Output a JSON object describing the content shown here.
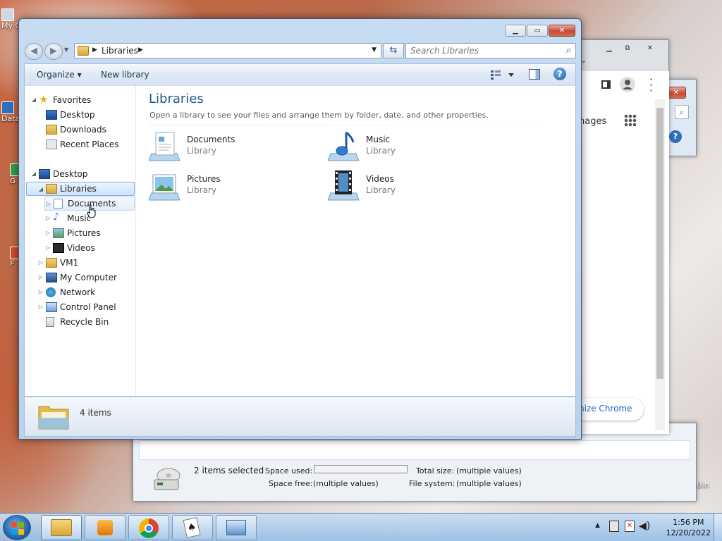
{
  "desktop": {
    "icons": [
      {
        "label": "My C"
      },
      {
        "label": "Data"
      },
      {
        "label": "G C"
      },
      {
        "label": "F"
      },
      {
        "label": "Bin"
      }
    ]
  },
  "background_chrome": {
    "images_link": "nages",
    "customize_button": "nize Chrome"
  },
  "background_props": {
    "selected": "2 items selected",
    "space_used_label": "Space used:",
    "space_free_label": "Space free:",
    "space_free_value": "(multiple values)",
    "total_size_label": "Total size:",
    "total_size_value": "(multiple values)",
    "file_system_label": "File system:",
    "file_system_value": "(multiple values)"
  },
  "explorer": {
    "address": "Libraries",
    "search_placeholder": "Search Libraries",
    "commands": {
      "organize": "Organize ▾",
      "new_library": "New library"
    },
    "tree": {
      "favorites": "Favorites",
      "desktop_fav": "Desktop",
      "downloads": "Downloads",
      "recent": "Recent Places",
      "desktop": "Desktop",
      "libraries": "Libraries",
      "documents": "Documents",
      "music": "Music",
      "pictures": "Pictures",
      "videos": "Videos",
      "vm1": "VM1",
      "my_computer": "My Computer",
      "network": "Network",
      "control_panel": "Control Panel",
      "recycle_bin": "Recycle Bin"
    },
    "main": {
      "title": "Libraries",
      "description": "Open a library to see your files and arrange them by folder, date, and other properties.",
      "libraries": [
        {
          "name": "Documents",
          "type": "Library"
        },
        {
          "name": "Music",
          "type": "Library"
        },
        {
          "name": "Pictures",
          "type": "Library"
        },
        {
          "name": "Videos",
          "type": "Library"
        }
      ]
    },
    "status": {
      "count": "4 items"
    }
  },
  "taskbar": {
    "time": "1:56 PM",
    "date": "12/20/2022"
  }
}
